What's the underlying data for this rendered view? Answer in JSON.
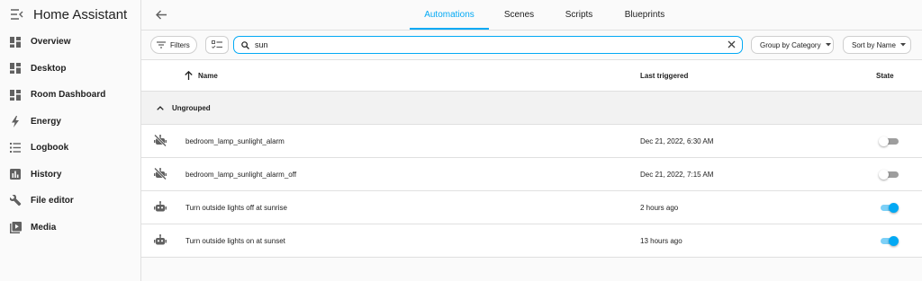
{
  "app": {
    "title": "Home Assistant"
  },
  "sidebar": {
    "items": [
      {
        "label": "Overview",
        "icon": "overview-icon"
      },
      {
        "label": "Desktop",
        "icon": "dashboard-icon"
      },
      {
        "label": "Room Dashboard",
        "icon": "dashboard-icon"
      },
      {
        "label": "Energy",
        "icon": "lightning-icon"
      },
      {
        "label": "Logbook",
        "icon": "list-icon"
      },
      {
        "label": "History",
        "icon": "chart-bar-icon"
      },
      {
        "label": "File editor",
        "icon": "wrench-icon"
      },
      {
        "label": "Media",
        "icon": "play-box-icon"
      }
    ]
  },
  "tabs": [
    {
      "label": "Automations",
      "active": true
    },
    {
      "label": "Scenes",
      "active": false
    },
    {
      "label": "Scripts",
      "active": false
    },
    {
      "label": "Blueprints",
      "active": false
    }
  ],
  "toolbar": {
    "filters_label": "Filters",
    "search_value": "sun",
    "group_label": "Group by Category",
    "sort_label": "Sort by Name"
  },
  "table": {
    "headers": {
      "name": "Name",
      "last_triggered": "Last triggered",
      "state": "State"
    },
    "group": {
      "label": "Ungrouped"
    },
    "rows": [
      {
        "name": "bedroom_lamp_sunlight_alarm",
        "last_triggered": "Dec 21, 2022, 6:30 AM",
        "enabled": false,
        "icon": "robot-off-icon"
      },
      {
        "name": "bedroom_lamp_sunlight_alarm_off",
        "last_triggered": "Dec 21, 2022, 7:15 AM",
        "enabled": false,
        "icon": "robot-off-icon"
      },
      {
        "name": "Turn outside lights off at sunrise",
        "last_triggered": "2 hours ago",
        "enabled": true,
        "icon": "robot-icon"
      },
      {
        "name": "Turn outside lights on at sunset",
        "last_triggered": "13 hours ago",
        "enabled": true,
        "icon": "robot-icon"
      }
    ]
  },
  "colors": {
    "accent": "#03a9f4",
    "text": "#212121",
    "icon": "#616161"
  }
}
